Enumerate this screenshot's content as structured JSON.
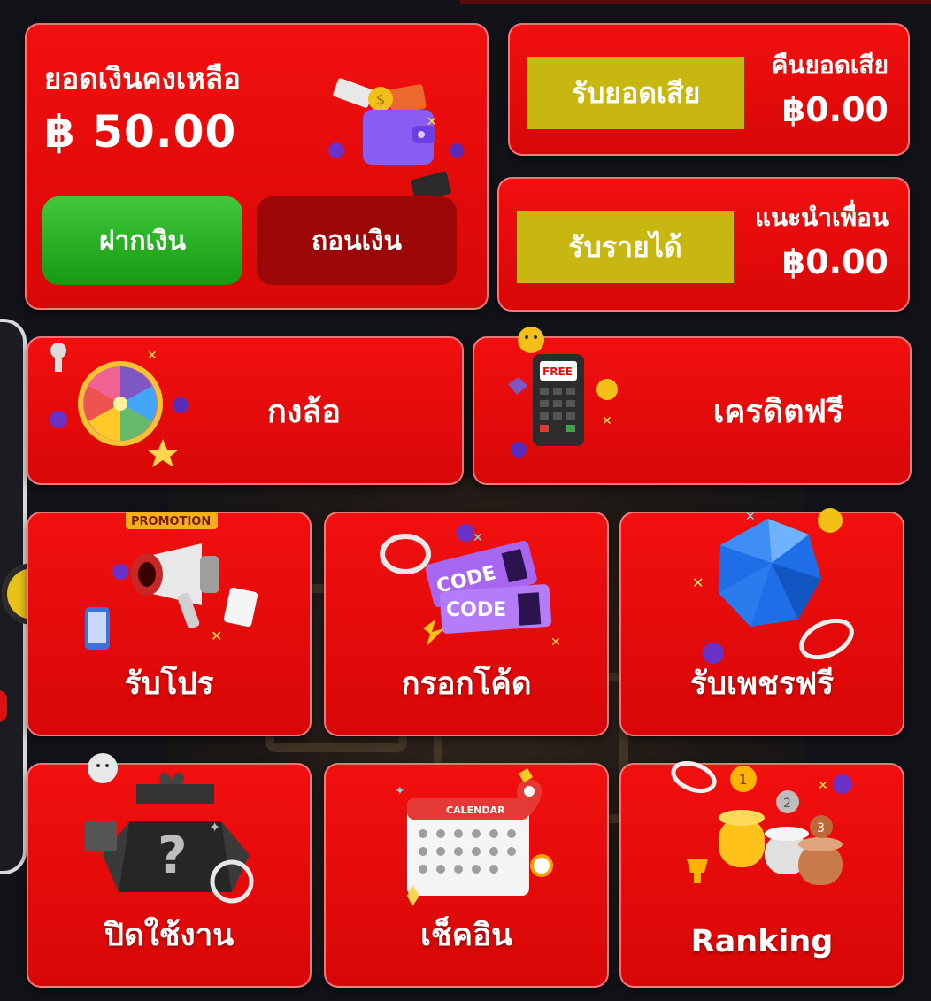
{
  "balance": {
    "title": "ยอดเงินคงเหลือ",
    "amount": "฿ 50.00",
    "deposit_label": "ฝากเงิน",
    "withdraw_label": "ถอนเงิน"
  },
  "cashback": {
    "button_label": "รับยอดเสีย",
    "label": "คืนยอดเสีย",
    "value": "฿0.00"
  },
  "referral": {
    "button_label": "รับรายได้",
    "label": "แนะนำเพื่อน",
    "value": "฿0.00"
  },
  "tiles": {
    "wheel": "กงล้อ",
    "free_credit": "เครดิตฟรี",
    "free_credit_badge": "FREE",
    "promo": "รับโปร",
    "promo_badge": "PROMOTION",
    "code": "กรอกโค้ด",
    "code_ticket": "CODE",
    "gems": "รับเพชรฟรี",
    "disabled": "ปิดใช้งาน",
    "checkin": "เช็คอิน",
    "checkin_calendar": "CALENDAR",
    "ranking": "Ranking"
  },
  "colors": {
    "panel_red": "#e60b0b",
    "deposit_green": "#1ea81a",
    "withdraw_dark_red": "#9c0606",
    "gold_button": "#c9b711",
    "background": "#121319"
  }
}
